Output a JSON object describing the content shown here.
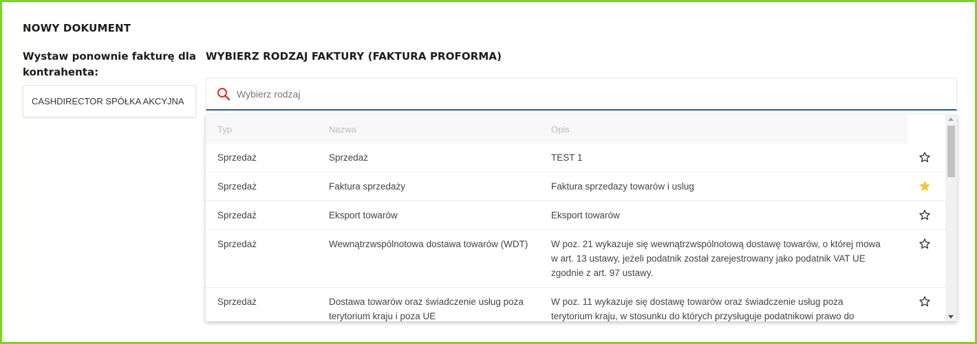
{
  "doc_title": "NOWY DOKUMENT",
  "left": {
    "heading": "Wystaw ponownie fakturę dla kontrahenta:",
    "contractor": "CASHDIRECTOR SPÓŁKA AKCYJNA"
  },
  "right": {
    "heading": "WYBIERZ RODZAJ FAKTURY (FAKTURA PROFORMA)",
    "search_placeholder": "Wybierz rodzaj"
  },
  "table": {
    "headers": {
      "typ": "Typ",
      "nazwa": "Nazwa",
      "opis": "Opis"
    },
    "rows": [
      {
        "typ": "Sprzedaż",
        "nazwa": "Sprzedaż",
        "opis": "TEST 1",
        "favorite": false
      },
      {
        "typ": "Sprzedaż",
        "nazwa": "Faktura sprzedaży",
        "opis": "Faktura sprzedazy towarów i uslug",
        "favorite": true
      },
      {
        "typ": "Sprzedaż",
        "nazwa": "Eksport towarów",
        "opis": "Eksport towarów",
        "favorite": false
      },
      {
        "typ": "Sprzedaż",
        "nazwa": "Wewnątrzwspólnotowa dostawa towarów (WDT)",
        "opis": "W poz. 21 wykazuje się wewnątrzwspólnotową dostawę towarów, o której mowa w art. 13 ustawy, jeżeli podatnik został zarejestrowany jako podatnik VAT UE zgodnie z art. 97 ustawy.",
        "favorite": false
      },
      {
        "typ": "Sprzedaż",
        "nazwa": "Dostawa towarów oraz świadczenie usług poza terytorium kraju i poza UE",
        "opis": "W poz. 11 wykazuje się dostawę towarów oraz świadczenie usług poza terytorium kraju, w stosunku do których przysługuje podatnikowi prawo do",
        "favorite": false
      }
    ]
  },
  "colors": {
    "frame_border": "#7ed321",
    "search_underline": "#1f5f8a",
    "search_icon": "#d0342c",
    "star_favorite": "#f0c640",
    "star_outline": "#333333"
  },
  "icons": {
    "search": "search-icon",
    "star_empty": "star-outline-icon",
    "star_filled": "star-filled-icon"
  }
}
